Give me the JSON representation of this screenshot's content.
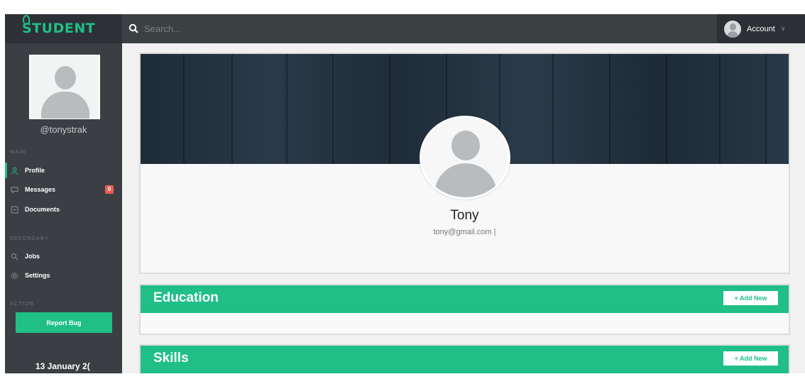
{
  "app": {
    "logo": "STUDENT"
  },
  "search": {
    "placeholder": "Search..."
  },
  "account": {
    "label": "Account"
  },
  "sidebar": {
    "username": "@tonystrak",
    "sections": {
      "main": "MAIN",
      "secondary": "SECONDARY",
      "action": "ACTION"
    },
    "items": [
      {
        "label": "Profile",
        "icon": "user-icon",
        "active": true
      },
      {
        "label": "Messages",
        "icon": "chat-icon",
        "badge": "0"
      },
      {
        "label": "Documents",
        "icon": "document-icon"
      },
      {
        "label": "Jobs",
        "icon": "search-icon"
      },
      {
        "label": "Settings",
        "icon": "gear-icon"
      }
    ],
    "report_button": "Report Bug",
    "date": "13 January 2("
  },
  "profile": {
    "name": "Tony",
    "email": "tony@gmail.com |"
  },
  "sections": [
    {
      "title": "Education",
      "add_label": "+ Add New"
    },
    {
      "title": "Skills",
      "add_label": "+ Add New"
    }
  ],
  "colors": {
    "accent": "#1fbf87",
    "sidebar": "#3b3f43",
    "topbar": "#3b4043",
    "badge": "#e85f56"
  }
}
